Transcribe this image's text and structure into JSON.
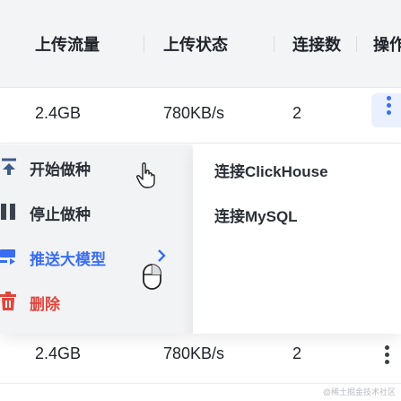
{
  "table": {
    "columns": [
      "上传流量",
      "上传状态",
      "连接数",
      "操作"
    ],
    "rows": [
      {
        "upload_traffic": "2.4GB",
        "upload_status": "780KB/s",
        "connections": "2"
      },
      {
        "upload_traffic": "2.4GB",
        "upload_status": "780KB/s",
        "connections": "2"
      }
    ]
  },
  "context_menu": {
    "items": [
      {
        "label": "开始做种",
        "icon": "upload-icon"
      },
      {
        "label": "停止做种",
        "icon": "pause-icon"
      },
      {
        "label": "推送大模型",
        "icon": "push-icon",
        "has_submenu": true
      },
      {
        "label": "删除",
        "icon": "trash-icon"
      }
    ],
    "submenu": [
      "连接ClickHouse",
      "连接MySQL"
    ]
  },
  "watermark": "@稀土掘金技术社区",
  "colors": {
    "accent": "#3a6df0",
    "danger": "#e0453c",
    "header_bg": "#f3f4f6",
    "menu_bg": "#f2f3f5"
  }
}
